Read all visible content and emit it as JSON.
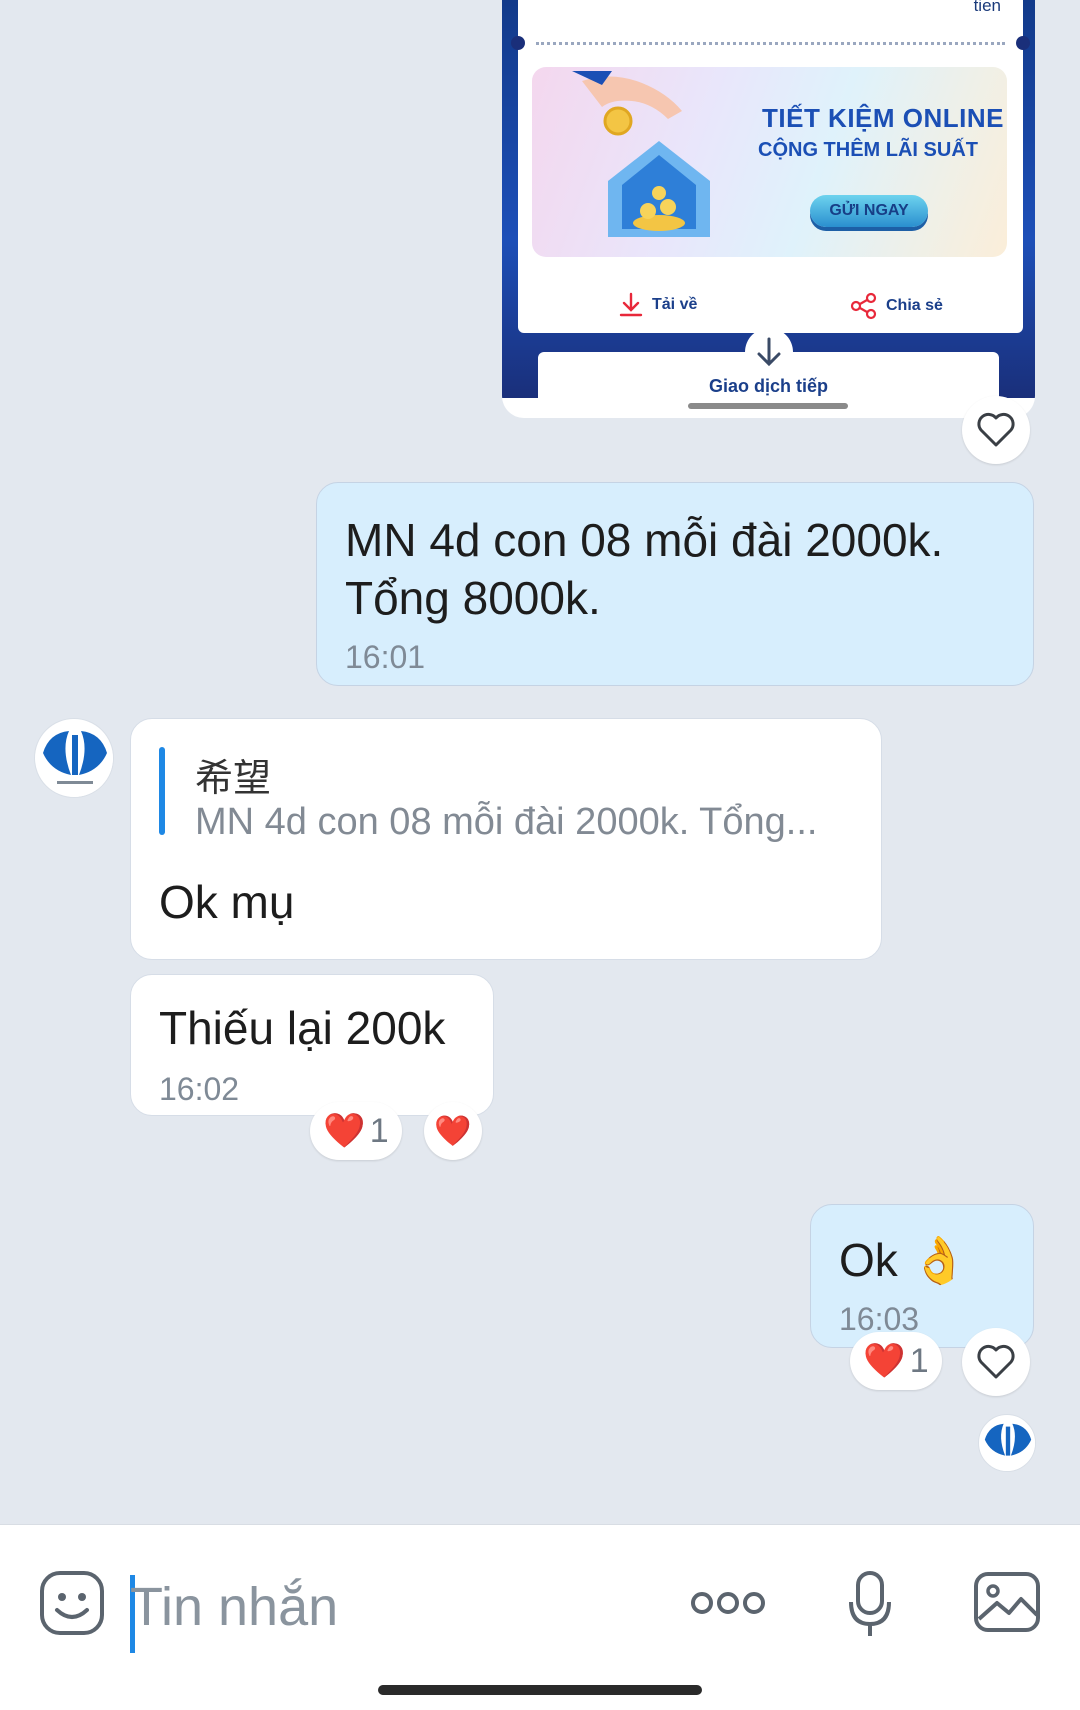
{
  "shared_image": {
    "corner_text": "tien",
    "banner_title": "TIẾT KIỆM ONLINE",
    "banner_subtitle": "CỘNG THÊM LÃI SUẤT",
    "banner_button": "GỬI NGAY",
    "download_label": "Tải về",
    "share_label": "Chia sẻ",
    "next_label": "Giao dịch tiếp"
  },
  "messages": [
    {
      "direction": "outgoing",
      "text": "MN 4d con 08 mỗi đài 2000k. Tổng 8000k.",
      "text_line1": "MN 4d con 08 mỗi đài 2000k.",
      "text_line2": "Tổng 8000k.",
      "time": "16:01"
    },
    {
      "direction": "incoming",
      "quote_author": "希望",
      "quote_text": "MN 4d con 08 mỗi đài 2000k. Tổng...",
      "text": "Ok mụ"
    },
    {
      "direction": "incoming",
      "text": "Thiếu lại 200k",
      "time": "16:02",
      "reaction": {
        "emoji": "❤️",
        "count": "1"
      }
    },
    {
      "direction": "outgoing",
      "text": "Ok 👌",
      "time": "16:03",
      "reaction": {
        "emoji": "❤️",
        "count": "1"
      }
    }
  ],
  "composer": {
    "placeholder": "Tin nhắn"
  },
  "colors": {
    "background": "#e3e8ef",
    "outgoing_bubble": "#d7eefd",
    "incoming_bubble": "#ffffff",
    "accent": "#1e88e5",
    "heart": "#e8283a"
  }
}
